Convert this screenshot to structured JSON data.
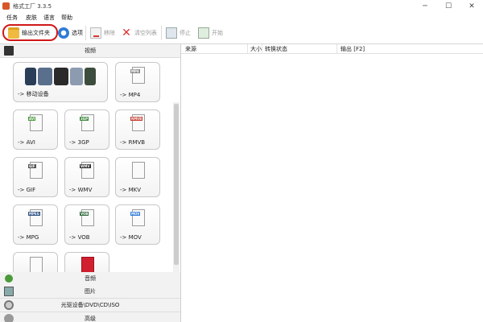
{
  "window": {
    "title": "格式工厂 3.3.5",
    "minimize": "─",
    "maximize": "☐",
    "close": "✕"
  },
  "menu": [
    "任务",
    "皮肤",
    "语言",
    "帮助"
  ],
  "toolbar": {
    "output_folder": "输出文件夹",
    "options": "选项",
    "remove": "移除",
    "clear_list": "清空列表",
    "stop": "停止",
    "start": "开始"
  },
  "categories": {
    "video": "视频",
    "audio": "音频",
    "picture": "图片",
    "disc": "光驱设备\\DVD\\CD\\ISO",
    "advanced": "高级"
  },
  "video_tiles": [
    {
      "label": "-> 移动设备",
      "badge": ""
    },
    {
      "label": "-> MP4",
      "badge": "MP4"
    },
    {
      "label": "-> AVI",
      "badge": "AVI"
    },
    {
      "label": "-> 3GP",
      "badge": "3GP"
    },
    {
      "label": "-> RMVB",
      "badge": "RMVB"
    },
    {
      "label": "-> GIF",
      "badge": "GIF"
    },
    {
      "label": "-> WMV",
      "badge": "WMV"
    },
    {
      "label": "-> MKV",
      "badge": ""
    },
    {
      "label": "-> MPG",
      "badge": "MPEG"
    },
    {
      "label": "-> VOB",
      "badge": "VOB"
    },
    {
      "label": "-> MOV",
      "badge": "MOV"
    }
  ],
  "list_columns": [
    "来源",
    "大小",
    "转换状态",
    "输出 [F2]"
  ],
  "colors": {
    "highlight": "#d01818",
    "accent": "#2f7bd6"
  }
}
